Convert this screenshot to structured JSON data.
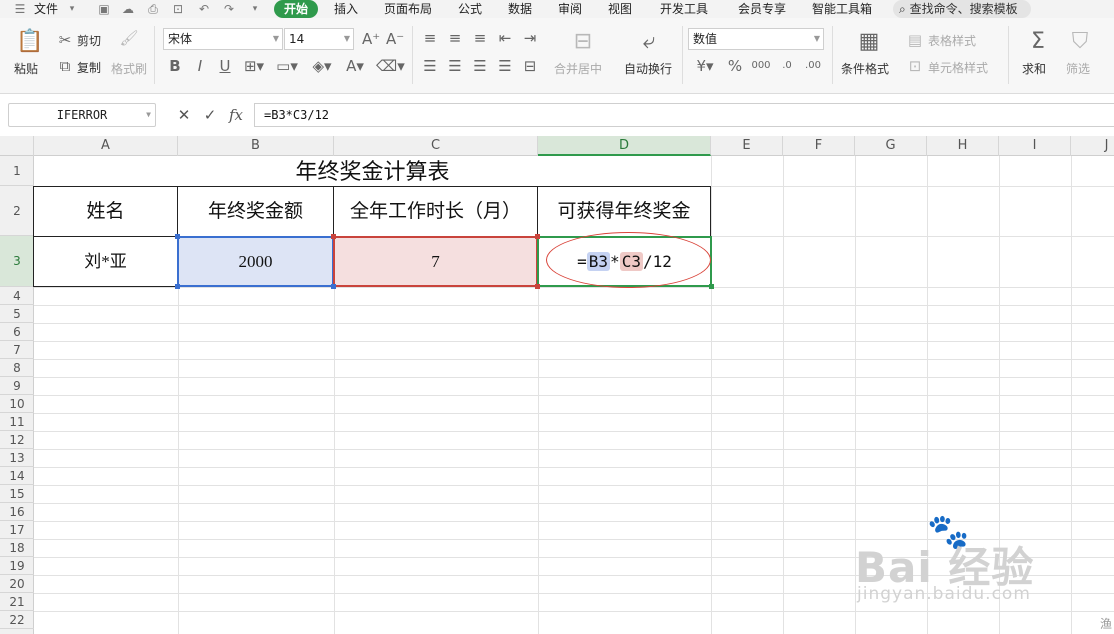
{
  "menubar": {
    "file_label": "文件",
    "tabs": [
      "开始",
      "插入",
      "页面布局",
      "公式",
      "数据",
      "审阅",
      "视图",
      "开发工具",
      "会员专享",
      "智能工具箱"
    ],
    "search_placeholder": "查找命令、搜索模板"
  },
  "ribbon": {
    "paste_label": "粘贴",
    "cut_label": "剪切",
    "copy_label": "复制",
    "format_painter_label": "格式刷",
    "font_name": "宋体",
    "font_size": "14",
    "merge_label": "合并居中",
    "wrap_label": "自动换行",
    "number_format": "数值",
    "conditional_format_label": "条件格式",
    "table_style_label": "表格样式",
    "cell_style_label": "单元格样式",
    "sum_label": "求和",
    "filter_label": "筛选"
  },
  "formula_bar": {
    "name_box": "IFERROR",
    "formula": "=B3*C3/12"
  },
  "sheet": {
    "columns": [
      "A",
      "B",
      "C",
      "D",
      "E",
      "F",
      "G",
      "H",
      "I",
      "J"
    ],
    "rows": [
      "1",
      "2",
      "3",
      "4",
      "5",
      "6",
      "7",
      "8",
      "9",
      "10",
      "11",
      "12",
      "13",
      "14",
      "15",
      "16",
      "17",
      "18",
      "19",
      "20",
      "21",
      "22"
    ],
    "active_column": "D",
    "active_row": "3",
    "title": "年终奖金计算表",
    "headers": [
      "姓名",
      "年终奖金额",
      "全年工作时长（月）",
      "可获得年终奖金"
    ],
    "row3": {
      "name": "刘*亚",
      "bonus": "2000",
      "months": "7",
      "formula_eq": "=",
      "ref_b": "B3",
      "op_mul": "*",
      "ref_c": "C3",
      "tail": "/12"
    }
  },
  "watermark": {
    "logo": "Bai 经验",
    "url": "jingyan.baidu.com"
  },
  "corner_text": "渔",
  "colors": {
    "accent_green": "#2f9a4c",
    "ref_blue": "#3a6fd0",
    "ref_red": "#c9443c"
  }
}
